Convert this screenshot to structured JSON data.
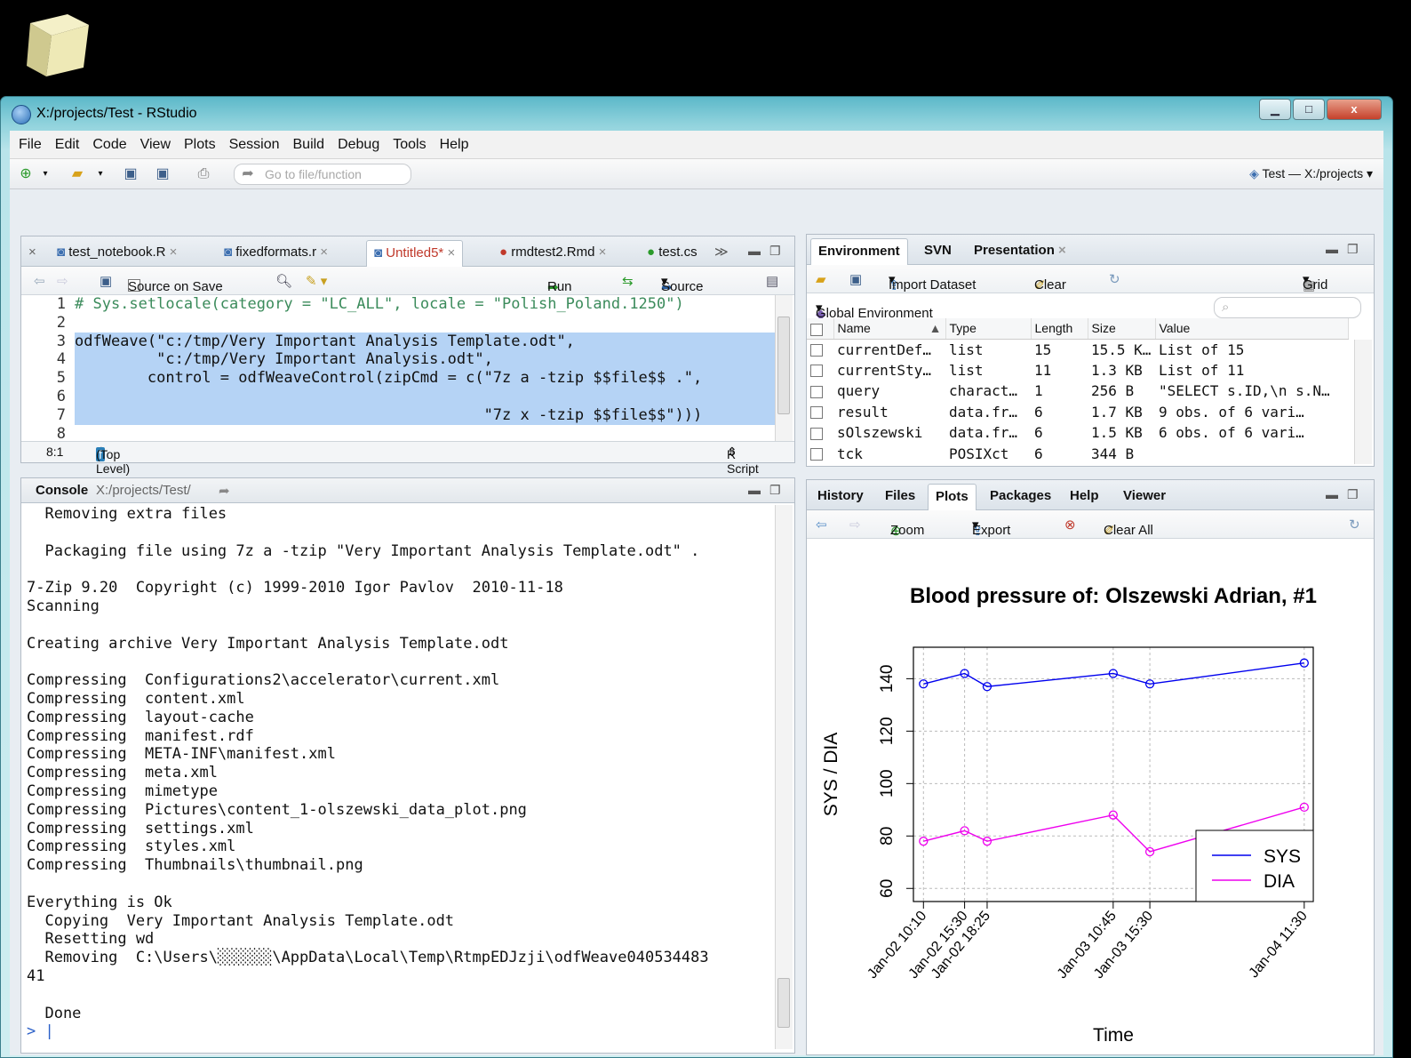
{
  "window": {
    "title": "X:/projects/Test - RStudio",
    "min": "▁",
    "max": "□",
    "close": "x"
  },
  "menu": [
    "File",
    "Edit",
    "Code",
    "View",
    "Plots",
    "Session",
    "Build",
    "Debug",
    "Tools",
    "Help"
  ],
  "toolbar": {
    "goto_placeholder": "Go to file/function",
    "project": "Test — X:/projects"
  },
  "editor": {
    "tabs": [
      "test_notebook.R",
      "fixedformats.r",
      "Untitled5*",
      "rmdtest2.Rmd",
      "test.cs"
    ],
    "source_on_save": "Source on Save",
    "run": "Run",
    "source": "Source",
    "lines": [
      {
        "n": "1",
        "text": "# Sys.setlocale(category = \"LC_ALL\", locale = \"Polish_Poland.1250\")"
      },
      {
        "n": "2",
        "text": ""
      },
      {
        "n": "3",
        "text": "odfWeave(\"c:/tmp/Very Important Analysis Template.odt\","
      },
      {
        "n": "4",
        "text": "         \"c:/tmp/Very Important Analysis.odt\","
      },
      {
        "n": "5",
        "text": "        control = odfWeaveControl(zipCmd = c(\"7z a -tzip $$file$$ .\","
      },
      {
        "n": "6",
        "text": ""
      },
      {
        "n": "7",
        "text": "                                             \"7z x -tzip $$file$$\")))"
      },
      {
        "n": "8",
        "text": ""
      }
    ],
    "status_pos": "8:1",
    "status_scope": "(Top Level)",
    "status_type": "R Script"
  },
  "env": {
    "tabs": [
      "Environment",
      "SVN",
      "Presentation"
    ],
    "import": "Import Dataset",
    "clear": "Clear",
    "grid": "Grid",
    "scope": "Global Environment",
    "headers": [
      "Name",
      "Type",
      "Length",
      "Size",
      "Value"
    ],
    "rows": [
      [
        "currentDef…",
        "list",
        "15",
        "15.5 K…",
        "List of 15"
      ],
      [
        "currentSty…",
        "list",
        "11",
        "1.3 KB",
        "List of 11"
      ],
      [
        "query",
        "charact…",
        "1",
        "256 B",
        "\"SELECT s.ID,\\n s.N…"
      ],
      [
        "result",
        "data.fr…",
        "6",
        "1.7 KB",
        "9 obs. of 6 vari…"
      ],
      [
        "sOlszewski",
        "data.fr…",
        "6",
        "1.5 KB",
        "6 obs. of 6 vari…"
      ],
      [
        "tck",
        "POSIXct",
        "6",
        "344 B",
        ""
      ]
    ]
  },
  "console": {
    "title": "Console",
    "path": "X:/projects/Test/",
    "lines": [
      "  Removing extra files",
      "",
      "  Packaging file using 7z a -tzip \"Very Important Analysis Template.odt\" .",
      "",
      "7-Zip 9.20  Copyright (c) 1999-2010 Igor Pavlov  2010-11-18",
      "Scanning",
      "",
      "Creating archive Very Important Analysis Template.odt",
      "",
      "Compressing  Configurations2\\accelerator\\current.xml",
      "Compressing  content.xml",
      "Compressing  layout-cache",
      "Compressing  manifest.rdf",
      "Compressing  META-INF\\manifest.xml",
      "Compressing  meta.xml",
      "Compressing  mimetype",
      "Compressing  Pictures\\content_1-olszewski_data_plot.png",
      "Compressing  settings.xml",
      "Compressing  styles.xml",
      "Compressing  Thumbnails\\thumbnail.png",
      "",
      "Everything is Ok",
      "  Copying  Very Important Analysis Template.odt",
      "  Resetting wd",
      "  Removing  C:\\Users\\░░░░░░\\AppData\\Local\\Temp\\RtmpEDJzji\\odfWeave040534483",
      "41",
      "",
      "  Done"
    ],
    "prompt": ">"
  },
  "plots": {
    "tabs": [
      "History",
      "Files",
      "Plots",
      "Packages",
      "Help",
      "Viewer"
    ],
    "zoom": "Zoom",
    "export": "Export",
    "clear_all": "Clear All"
  },
  "chart_data": {
    "type": "line",
    "title": "Blood pressure of: Olszewski Adrian, #1",
    "xlabel": "Time",
    "ylabel": "SYS / DIA",
    "x": [
      "Jan-02 10:10",
      "Jan-02 15:30",
      "Jan-02 18:25",
      "Jan-03 10:45",
      "Jan-03 15:30",
      "Jan-04 11:30"
    ],
    "x_hours": [
      0,
      5.33,
      8.25,
      24.58,
      29.33,
      49.33
    ],
    "ylim": [
      55,
      152
    ],
    "yticks": [
      60,
      80,
      100,
      120,
      140
    ],
    "series": [
      {
        "name": "SYS",
        "color": "#0000ee",
        "values": [
          138,
          142,
          137,
          142,
          138,
          146
        ]
      },
      {
        "name": "DIA",
        "color": "#ee00ee",
        "values": [
          78,
          82,
          78,
          88,
          74,
          91
        ]
      }
    ],
    "legend": "bottom-right",
    "grid": true
  }
}
